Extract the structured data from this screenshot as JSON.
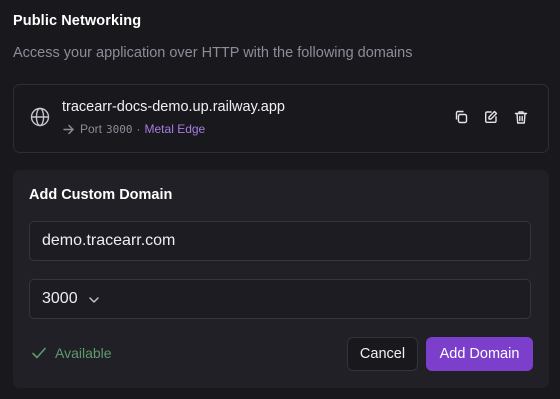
{
  "section": {
    "title": "Public Networking",
    "description": "Access your application over HTTP with the following domains"
  },
  "domain_card": {
    "icon": "globe-icon",
    "domain": "tracearr-docs-demo.up.railway.app",
    "port_label": "Port",
    "port": "3000",
    "separator": "·",
    "edge": "Metal Edge",
    "actions": [
      "copy-icon",
      "edit-icon",
      "trash-icon"
    ]
  },
  "add_panel": {
    "title": "Add Custom Domain",
    "domain_value": "demo.tracearr.com",
    "port_value": "3000",
    "status": "Available",
    "cancel_label": "Cancel",
    "add_label": "Add Domain"
  },
  "colors": {
    "accent": "#7c3fcc",
    "edge_text": "#a77de6",
    "available": "#5f9a6d"
  }
}
